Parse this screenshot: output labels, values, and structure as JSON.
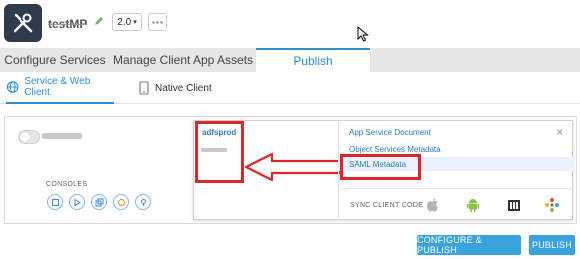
{
  "app": {
    "name": "testMP",
    "version": "2.0"
  },
  "tabs": [
    {
      "label": "Configure Services"
    },
    {
      "label": "Manage Client App Assets"
    },
    {
      "label": "Publish"
    }
  ],
  "subtabs": [
    {
      "label": "Service & Web Client"
    },
    {
      "label": "Native Client"
    }
  ],
  "card": {
    "consoles_label": "CONSOLES",
    "env_name": "adfsprod",
    "menu": [
      {
        "label": "App Service Document"
      },
      {
        "label": "Object Services Metadata"
      },
      {
        "label": "SAML Metadata"
      }
    ],
    "sync_label": "SYNC CLIENT CODE",
    "close_glyph": "×"
  },
  "buttons": {
    "configure_publish": "CONFIGURE & PUBLISH",
    "publish": "PUBLISH"
  },
  "colors": {
    "accent": "#2e8fd0",
    "annotation_red": "#e0262b",
    "button": "#3aa3dd"
  }
}
